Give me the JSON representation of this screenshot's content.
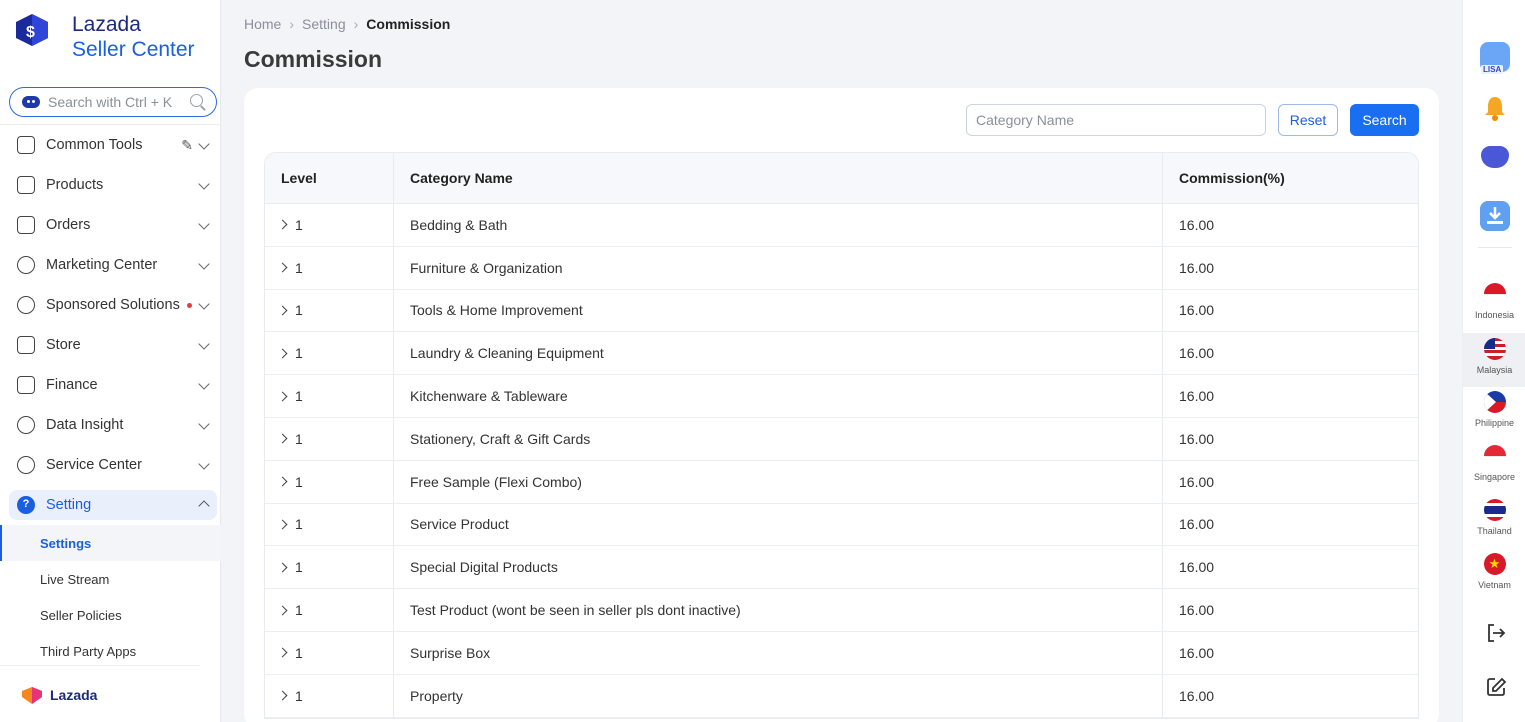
{
  "brand": {
    "line1": "Lazada",
    "line2": "Seller Center",
    "footer": "Lazada",
    "colors": {
      "primary": "#1a5fe0",
      "dark": "#1b2a7a",
      "accent_orange": "#f5871f",
      "accent_pink": "#e8327a"
    }
  },
  "sidebar": {
    "search_placeholder": "Search with Ctrl + K",
    "items": [
      {
        "label": "Common Tools",
        "icon": "lightbulb-icon"
      },
      {
        "label": "Products",
        "icon": "bag-icon"
      },
      {
        "label": "Orders",
        "icon": "receipt-icon"
      },
      {
        "label": "Marketing Center",
        "icon": "trend-icon"
      },
      {
        "label": "Sponsored Solutions",
        "icon": "people-dollar-icon"
      },
      {
        "label": "Store",
        "icon": "storefront-icon"
      },
      {
        "label": "Finance",
        "icon": "wallet-icon"
      },
      {
        "label": "Data Insight",
        "icon": "chart-icon"
      },
      {
        "label": "Service Center",
        "icon": "headset-icon"
      },
      {
        "label": "Setting",
        "icon": "question-icon"
      }
    ],
    "setting_sub": [
      "Settings",
      "Live Stream",
      "Seller Policies",
      "Third Party Apps"
    ]
  },
  "breadcrumb": {
    "home": "Home",
    "setting": "Setting",
    "current": "Commission"
  },
  "page_title": "Commission",
  "filter": {
    "placeholder": "Category Name",
    "reset": "Reset",
    "search": "Search"
  },
  "table": {
    "headers": [
      "Level",
      "Category Name",
      "Commission(%)"
    ],
    "rows": [
      {
        "level": "1",
        "name": "Bedding & Bath",
        "commission": "16.00"
      },
      {
        "level": "1",
        "name": "Furniture & Organization",
        "commission": "16.00"
      },
      {
        "level": "1",
        "name": "Tools & Home Improvement",
        "commission": "16.00"
      },
      {
        "level": "1",
        "name": "Laundry & Cleaning Equipment",
        "commission": "16.00"
      },
      {
        "level": "1",
        "name": "Kitchenware & Tableware",
        "commission": "16.00"
      },
      {
        "level": "1",
        "name": "Stationery, Craft & Gift Cards",
        "commission": "16.00"
      },
      {
        "level": "1",
        "name": "Free Sample (Flexi Combo)",
        "commission": "16.00"
      },
      {
        "level": "1",
        "name": "Service Product",
        "commission": "16.00"
      },
      {
        "level": "1",
        "name": "Special Digital Products",
        "commission": "16.00"
      },
      {
        "level": "1",
        "name": "Test Product (wont be seen in seller pls dont inactive)",
        "commission": "16.00"
      },
      {
        "level": "1",
        "name": "Surprise Box",
        "commission": "16.00"
      },
      {
        "level": "1",
        "name": "Property",
        "commission": "16.00"
      }
    ]
  },
  "rail": {
    "lisa_badge": "LISA",
    "countries": [
      "Indonesia",
      "Malaysia",
      "Philippine",
      "Singapore",
      "Thailand",
      "Vietnam"
    ],
    "selected_country": "Malaysia"
  }
}
